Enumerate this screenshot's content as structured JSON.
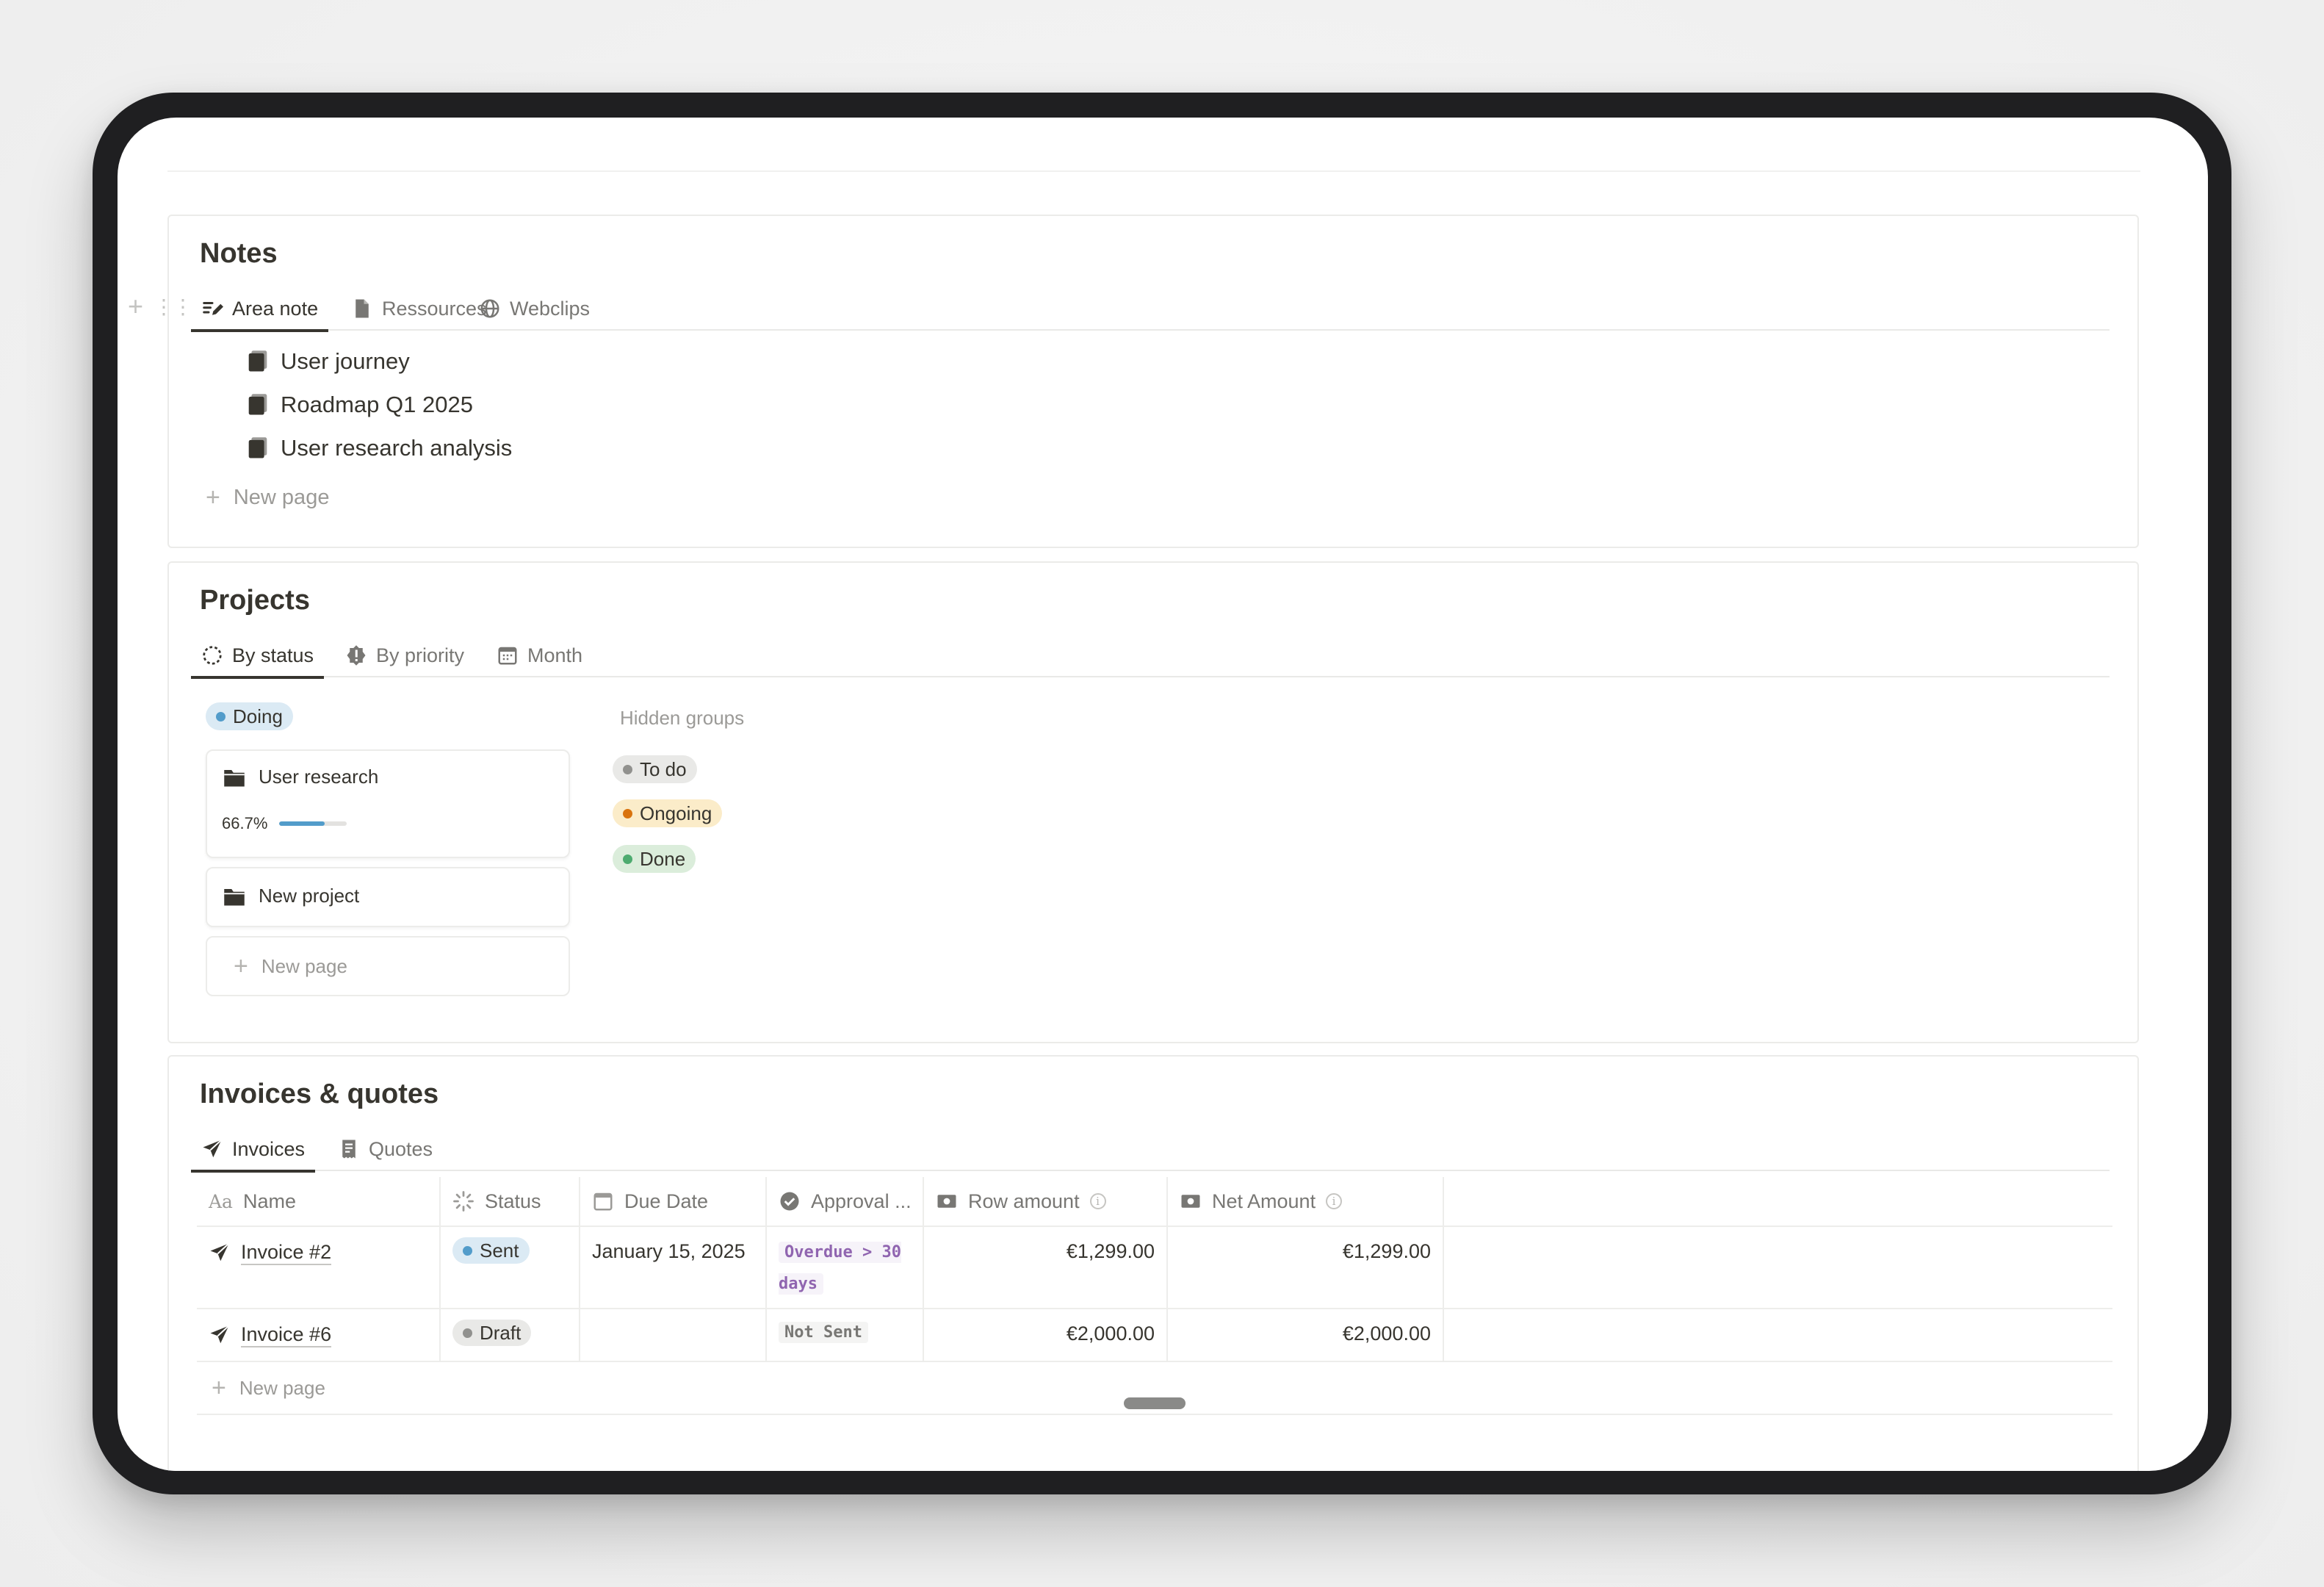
{
  "notes": {
    "title": "Notes",
    "tabs": [
      {
        "label": "Area note",
        "icon": "edit-note-icon",
        "active": true
      },
      {
        "label": "Ressources",
        "icon": "document-icon",
        "active": false
      },
      {
        "label": "Webclips",
        "icon": "globe-icon",
        "active": false
      }
    ],
    "pages": [
      "User journey",
      "Roadmap Q1 2025",
      "User research analysis"
    ],
    "new_page_label": "New page"
  },
  "projects": {
    "title": "Projects",
    "tabs": [
      {
        "label": "By status",
        "icon": "status-circle-icon",
        "active": true
      },
      {
        "label": "By priority",
        "icon": "priority-icon",
        "active": false
      },
      {
        "label": "Month",
        "icon": "calendar-icon",
        "active": false
      }
    ],
    "group": {
      "label": "Doing",
      "color": "#529cca",
      "bg": "#dbeaf4"
    },
    "cards": [
      {
        "title": "User research",
        "icon": "folder-icon",
        "progress_text": "66.7%",
        "progress": 0.667
      },
      {
        "title": "New project",
        "icon": "folder-icon"
      }
    ],
    "new_page_label": "New page",
    "hidden_groups_label": "Hidden groups",
    "hidden_groups": [
      {
        "label": "To do",
        "color": "#91918e",
        "bg": "#e9e9e7"
      },
      {
        "label": "Ongoing",
        "color": "#d9730d",
        "bg": "#fbecc9"
      },
      {
        "label": "Done",
        "color": "#4dab6f",
        "bg": "#dbeddb"
      }
    ]
  },
  "invoices": {
    "title": "Invoices & quotes",
    "tabs": [
      {
        "label": "Invoices",
        "icon": "send-icon",
        "active": true
      },
      {
        "label": "Quotes",
        "icon": "receipt-icon",
        "active": false
      }
    ],
    "columns": [
      {
        "label": "Name",
        "icon": "text-icon"
      },
      {
        "label": "Status",
        "icon": "status-icon"
      },
      {
        "label": "Due Date",
        "icon": "calendar-icon"
      },
      {
        "label": "Approval ...",
        "icon": "check-circle-icon"
      },
      {
        "label": "Row amount",
        "icon": "money-icon"
      },
      {
        "label": "Net Amount",
        "icon": "money-icon"
      }
    ],
    "rows": [
      {
        "name": "Invoice #2",
        "status": "Sent",
        "status_color": "#529cca",
        "status_bg": "#dbeaf4",
        "due": "January 15, 2025",
        "approval": "Overdue > 30 days",
        "approval_color": "#9065b0",
        "row_amount": "€1,299.00",
        "net_amount": "€1,299.00"
      },
      {
        "name": "Invoice #6",
        "status": "Draft",
        "status_color": "#91918e",
        "status_bg": "#e9e9e7",
        "due": "",
        "approval": "Not Sent",
        "approval_color": "#787774",
        "row_amount": "€2,000.00",
        "net_amount": "€2,000.00"
      }
    ],
    "new_page_label": "New page"
  }
}
